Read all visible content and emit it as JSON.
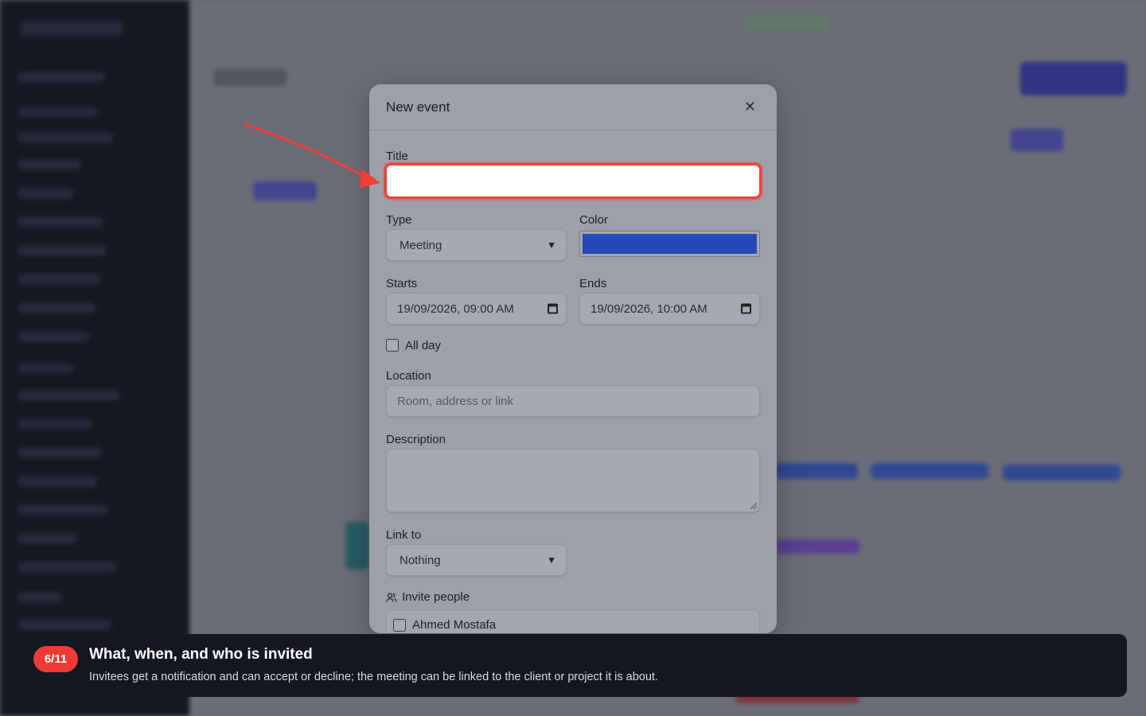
{
  "modal": {
    "title": "New event",
    "close_icon": "close-icon",
    "title_label": "Title",
    "title_value": "",
    "type_label": "Type",
    "type_value": "Meeting",
    "color_label": "Color",
    "color_value": "#2448b7",
    "starts_label": "Starts",
    "starts_value": "19/09/2026, 09:00 AM",
    "ends_label": "Ends",
    "ends_value": "19/09/2026, 10:00 AM",
    "all_day_label": "All day",
    "all_day_checked": false,
    "location_label": "Location",
    "location_placeholder": "Room, address or link",
    "description_label": "Description",
    "description_value": "",
    "link_to_label": "Link to",
    "link_to_value": "Nothing",
    "invite_label": "Invite people",
    "invitees": [
      {
        "name": "Ahmed Mostafa",
        "checked": false
      }
    ]
  },
  "tour": {
    "step": "6/11",
    "title": "What, when, and who is invited",
    "description": "Invitees get a notification and can accept or decline; the meeting can be linked to the client or project it is about."
  },
  "colors": {
    "highlight": "#f43d36",
    "badge": "#ef3b33",
    "accent_event": "#2448b7"
  }
}
